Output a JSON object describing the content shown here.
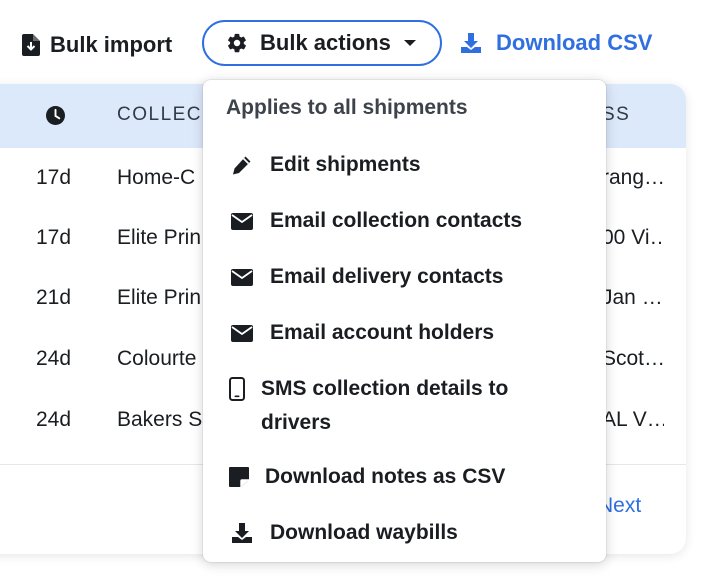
{
  "toolbar": {
    "bulk_import_label": "Bulk import",
    "bulk_actions_label": "Bulk actions",
    "download_csv_label": "Download CSV"
  },
  "table": {
    "headers": {
      "age_icon": "clock-icon",
      "collection": "COLLEC",
      "address": "SS"
    },
    "rows": [
      {
        "age": "17d",
        "name": "Home-C",
        "address": "rang…"
      },
      {
        "age": "17d",
        "name": "Elite Prin",
        "address": "00 Vi…"
      },
      {
        "age": "21d",
        "name": "Elite Prin",
        "address": "Jan …"
      },
      {
        "age": "24d",
        "name": "Colourte",
        "address": "Scot…"
      },
      {
        "age": "24d",
        "name": "Bakers S",
        "address": "AL V…"
      }
    ],
    "next_label": "Next"
  },
  "menu": {
    "heading": "Applies to all shipments",
    "items": [
      {
        "label": "Edit shipments",
        "icon": "pencil-icon"
      },
      {
        "label": "Email collection contacts",
        "icon": "envelope-icon"
      },
      {
        "label": "Email delivery contacts",
        "icon": "envelope-icon"
      },
      {
        "label": "Email account holders",
        "icon": "envelope-icon"
      },
      {
        "label": "SMS collection details to drivers",
        "line1": "SMS collection details to",
        "line2": "drivers",
        "icon": "mobile-phone-icon"
      },
      {
        "label": "Download notes as CSV",
        "icon": "sticky-note-icon"
      },
      {
        "label": "Download waybills",
        "icon": "download-icon"
      }
    ]
  },
  "colors": {
    "accent": "#2f6fe0",
    "header_bg": "#dce9fb",
    "text": "#1a1d21"
  }
}
